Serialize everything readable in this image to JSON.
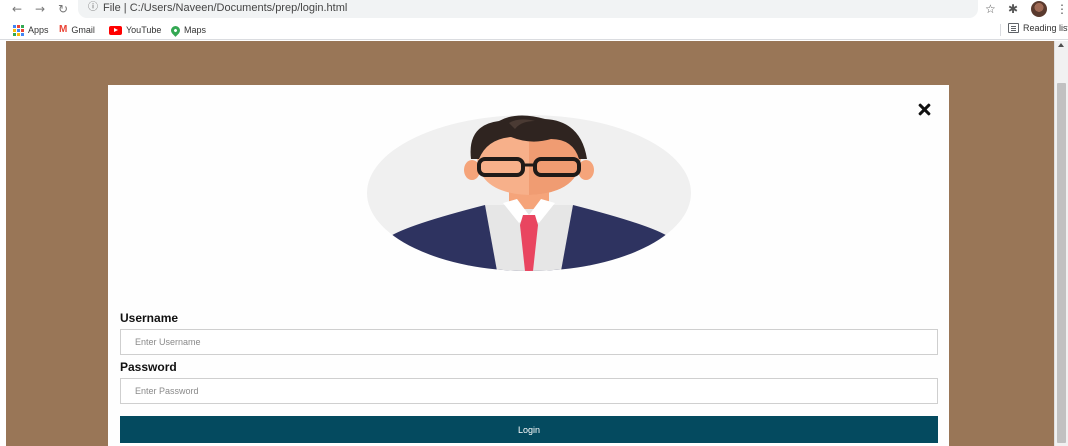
{
  "browser": {
    "nav": {
      "back": "←",
      "forward": "→",
      "reload": "↻"
    },
    "address_bar": {
      "info_icon": "ⓘ",
      "url": "File  |  C:/Users/Naveen/Documents/prep/login.html"
    },
    "toolbar_icons": {
      "star": "☆",
      "extensions": "✱",
      "menu": "⋮"
    }
  },
  "bookmarks": [
    {
      "label": "Apps",
      "icon": "apps-grid-icon"
    },
    {
      "label": "Gmail",
      "icon": "gmail-icon"
    },
    {
      "label": "YouTube",
      "icon": "youtube-icon"
    },
    {
      "label": "Maps",
      "icon": "maps-icon"
    }
  ],
  "reading_list": {
    "label": "Reading list"
  },
  "page": {
    "background_color": "#997657",
    "modal": {
      "close_icon": "close-icon",
      "avatar_icon": "user-avatar-icon",
      "username": {
        "label": "Username",
        "placeholder": "Enter Username",
        "value": ""
      },
      "password": {
        "label": "Password",
        "placeholder": "Enter Password",
        "value": ""
      },
      "login_button": {
        "label": "Login",
        "color": "#044a5f"
      }
    }
  }
}
